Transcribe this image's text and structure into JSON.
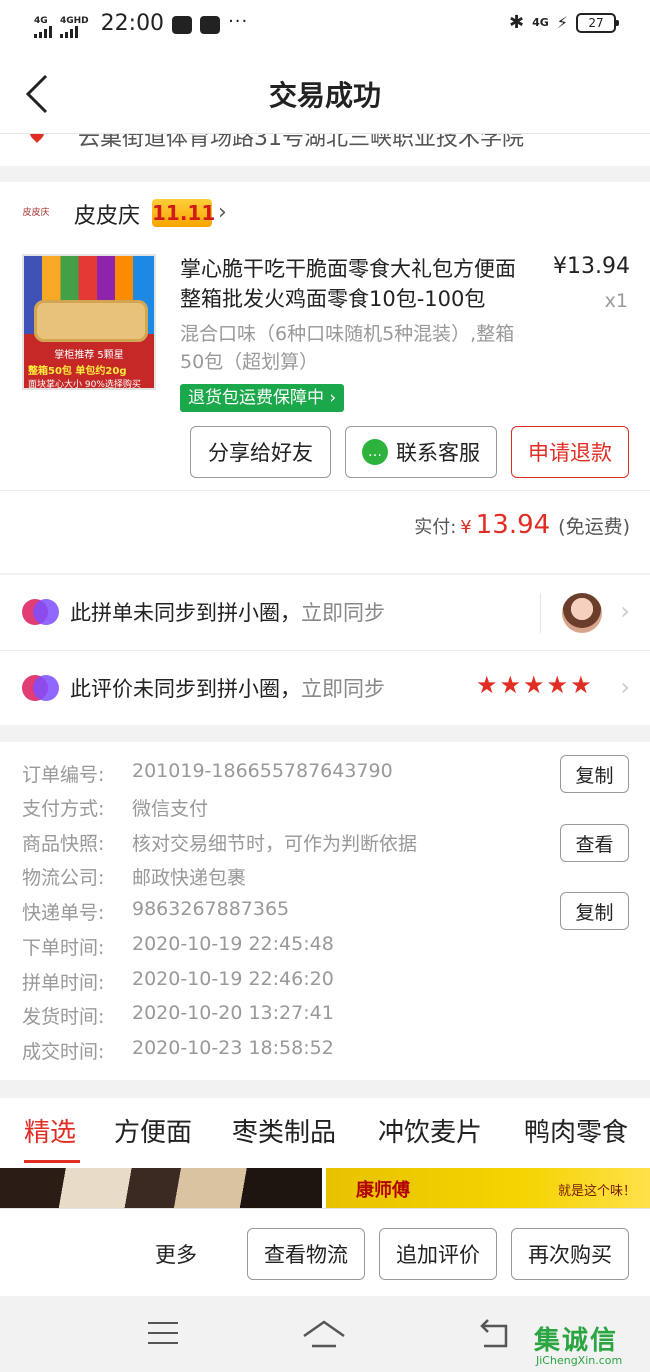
{
  "status_bar": {
    "net1": "4G",
    "net2": "4GHD",
    "time": "22:00",
    "dots": "···",
    "net3": "4G",
    "battery": "27"
  },
  "nav": {
    "title": "交易成功"
  },
  "address": {
    "partial_text": "云巢街道体育场路31号湖北三峡职业技术学院"
  },
  "shop": {
    "logo_text": "皮皮庆",
    "name": "皮皮庆",
    "badge": "11.11"
  },
  "product": {
    "image_tag": "掌柜推荐 5颗星",
    "image_promo": "整箱50包 单包约20g",
    "image_caption": "面块掌心大小 90%选择购买",
    "title": "掌心脆干吃干脆面零食大礼包方便面整箱批发火鸡面零食10包-100包",
    "price": "¥13.94",
    "qty": "x1",
    "spec": "混合口味（6种口味随机5种混装）,整箱50包（超划算）",
    "guarantee": "退货包运费保障中 ›"
  },
  "buttons": {
    "share": "分享给好友",
    "service": "联系客服",
    "refund": "申请退款"
  },
  "paid": {
    "label": "实付:",
    "currency": "¥",
    "amount": "13.94",
    "note": "(免运费)"
  },
  "sync": {
    "row1_text": "此拼单未同步到拼小圈，",
    "row1_link": "立即同步",
    "row2_text": "此评价未同步到拼小圈，",
    "row2_link": "立即同步",
    "rating": 5
  },
  "order_info": [
    {
      "label": "订单编号:",
      "value": "201019-186655787643790",
      "action": "复制"
    },
    {
      "label": "支付方式:",
      "value": "微信支付",
      "action": ""
    },
    {
      "label": "商品快照:",
      "value": "核对交易细节时，可作为判断依据",
      "action": "查看"
    },
    {
      "label": "物流公司:",
      "value": "邮政快递包裹",
      "action": ""
    },
    {
      "label": "快递单号:",
      "value": "9863267887365",
      "action": "复制"
    },
    {
      "label": "下单时间:",
      "value": "2020-10-19 22:45:48",
      "action": ""
    },
    {
      "label": "拼单时间:",
      "value": "2020-10-19 22:46:20",
      "action": ""
    },
    {
      "label": "发货时间:",
      "value": "2020-10-20 13:27:41",
      "action": ""
    },
    {
      "label": "成交时间:",
      "value": "2020-10-23 18:58:52",
      "action": ""
    }
  ],
  "tabs": [
    "精选",
    "方便面",
    "枣类制品",
    "冲饮麦片",
    "鸭肉零食"
  ],
  "banner": {
    "brand": "康师傅",
    "slogan": "就是这个味！"
  },
  "actions": {
    "more": "更多",
    "logistics": "查看物流",
    "review": "追加评价",
    "rebuy": "再次购买"
  },
  "watermark": {
    "text": "集诚信",
    "domain": "JiChengXin.com"
  },
  "colors": {
    "accent": "#e02e24",
    "guarantee_green": "#1aa84a",
    "wechat_green": "#2db33d"
  }
}
